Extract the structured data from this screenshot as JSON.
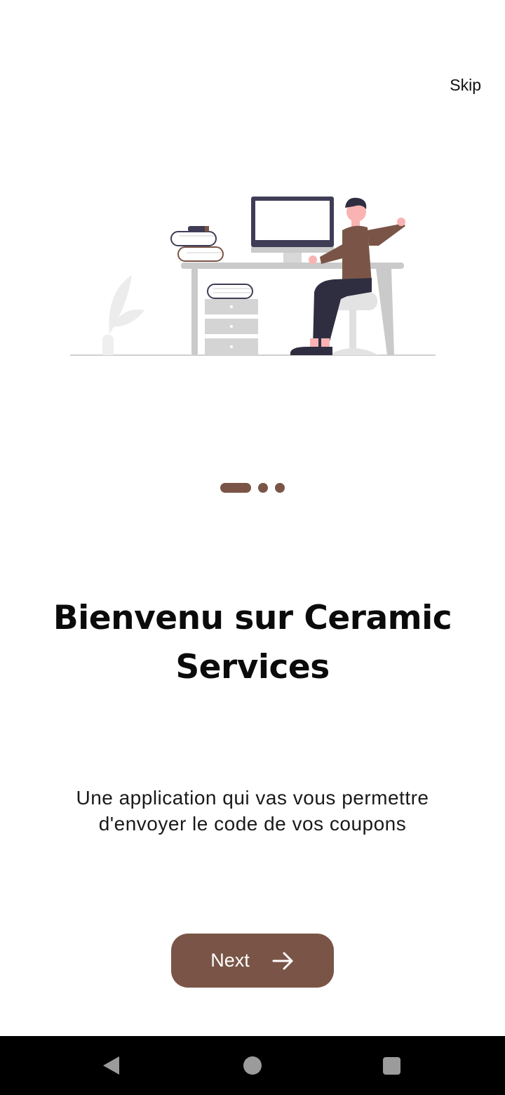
{
  "header": {
    "skip_label": "Skip"
  },
  "illustration": {
    "name": "person-at-desk-illustration"
  },
  "pager": {
    "total": 3,
    "active_index": 0,
    "color": "#7a5547"
  },
  "content": {
    "title": "Bienvenu sur Ceramic Services",
    "subtitle": "Une application qui vas vous permettre d'envoyer le code de vos coupons"
  },
  "actions": {
    "next_label": "Next",
    "next_icon": "arrow-right-icon",
    "accent": "#7a5547"
  },
  "system_nav": {
    "back_icon": "back-triangle-icon",
    "home_icon": "home-circle-icon",
    "recents_icon": "recents-square-icon"
  }
}
